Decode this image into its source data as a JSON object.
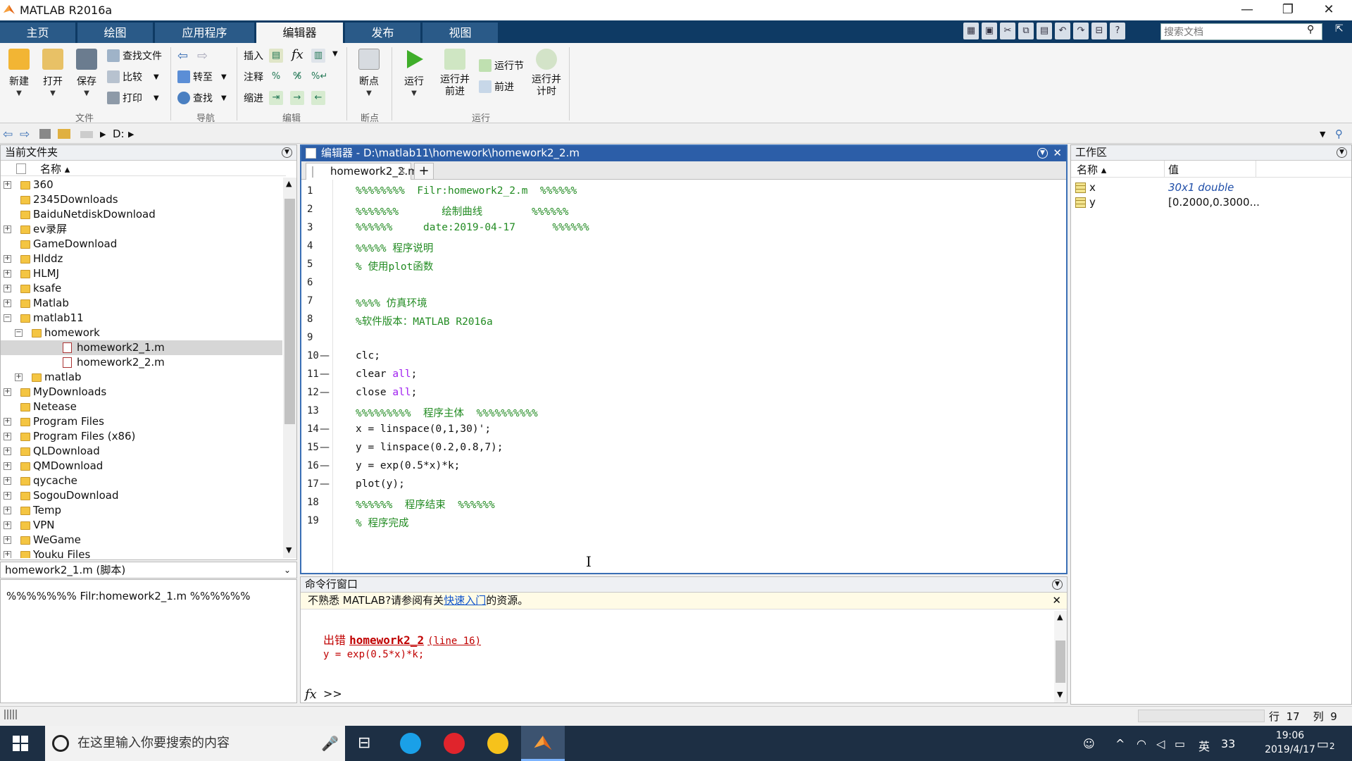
{
  "window": {
    "title": "MATLAB R2016a"
  },
  "ribbon_tabs": [
    "主页",
    "绘图",
    "应用程序",
    "编辑器",
    "发布",
    "视图"
  ],
  "search": {
    "placeholder": "搜索文档"
  },
  "ribbon": {
    "file": {
      "new": "新建",
      "open": "打开",
      "save": "保存",
      "find_files": "查找文件",
      "compare": "比较",
      "print": "打印",
      "group": "文件"
    },
    "nav": {
      "goto": "转至",
      "find": "查找",
      "group": "导航"
    },
    "edit": {
      "insert": "插入",
      "comment": "注释",
      "indent": "缩进",
      "fx": "fx",
      "group": "编辑"
    },
    "breakpoints": {
      "label": "断点",
      "group": "断点"
    },
    "run": {
      "run": "运行",
      "run_advance_1": "运行并",
      "run_advance_2": "前进",
      "run_section": "运行节",
      "advance": "前进",
      "run_time_1": "运行并",
      "run_time_2": "计时",
      "group": "运行"
    }
  },
  "address": {
    "drive": "D:"
  },
  "folder_panel": {
    "title": "当前文件夹",
    "col_name": "名称 ▴",
    "items": [
      {
        "name": "360",
        "depth": 0,
        "exp": "+",
        "type": "folder"
      },
      {
        "name": "2345Downloads",
        "depth": 0,
        "exp": "",
        "type": "folder"
      },
      {
        "name": "BaiduNetdiskDownload",
        "depth": 0,
        "exp": "",
        "type": "folder"
      },
      {
        "name": "ev录屏",
        "depth": 0,
        "exp": "+",
        "type": "folder"
      },
      {
        "name": "GameDownload",
        "depth": 0,
        "exp": "",
        "type": "folder"
      },
      {
        "name": "Hlddz",
        "depth": 0,
        "exp": "+",
        "type": "folder"
      },
      {
        "name": "HLMJ",
        "depth": 0,
        "exp": "+",
        "type": "folder"
      },
      {
        "name": "ksafe",
        "depth": 0,
        "exp": "+",
        "type": "folder"
      },
      {
        "name": "Matlab",
        "depth": 0,
        "exp": "+",
        "type": "folder"
      },
      {
        "name": "matlab11",
        "depth": 0,
        "exp": "−",
        "type": "folder"
      },
      {
        "name": "homework",
        "depth": 1,
        "exp": "−",
        "type": "folder"
      },
      {
        "name": "homework2_1.m",
        "depth": 2,
        "exp": "",
        "type": "mfile",
        "selected": true
      },
      {
        "name": "homework2_2.m",
        "depth": 2,
        "exp": "",
        "type": "mfile"
      },
      {
        "name": "matlab",
        "depth": 1,
        "exp": "+",
        "type": "folder"
      },
      {
        "name": "MyDownloads",
        "depth": 0,
        "exp": "+",
        "type": "folder"
      },
      {
        "name": "Netease",
        "depth": 0,
        "exp": "",
        "type": "folder"
      },
      {
        "name": "Program Files",
        "depth": 0,
        "exp": "+",
        "type": "folder"
      },
      {
        "name": "Program Files (x86)",
        "depth": 0,
        "exp": "+",
        "type": "folder"
      },
      {
        "name": "QLDownload",
        "depth": 0,
        "exp": "+",
        "type": "folder"
      },
      {
        "name": "QMDownload",
        "depth": 0,
        "exp": "+",
        "type": "folder"
      },
      {
        "name": "qycache",
        "depth": 0,
        "exp": "+",
        "type": "folder"
      },
      {
        "name": "SogouDownload",
        "depth": 0,
        "exp": "+",
        "type": "folder"
      },
      {
        "name": "Temp",
        "depth": 0,
        "exp": "+",
        "type": "folder"
      },
      {
        "name": "VPN",
        "depth": 0,
        "exp": "+",
        "type": "folder"
      },
      {
        "name": "WeGame",
        "depth": 0,
        "exp": "+",
        "type": "folder"
      },
      {
        "name": "Youku Files",
        "depth": 0,
        "exp": "+",
        "type": "folder"
      }
    ]
  },
  "details": {
    "title": "homework2_1.m (脚本)",
    "content": "%%%%%%% Filr:homework2_1.m %%%%%%"
  },
  "editor": {
    "title": "编辑器 - D:\\matlab11\\homework\\homework2_2.m",
    "tab": "homework2_2.m",
    "lines": [
      {
        "n": "1",
        "dash": "",
        "parts": [
          {
            "t": "%%%%%%%%  Filr:homework2_2.m  %%%%%%",
            "c": "cmt"
          }
        ]
      },
      {
        "n": "2",
        "dash": "",
        "parts": [
          {
            "t": "%%%%%%%       绘制曲线        %%%%%%",
            "c": "cmt"
          }
        ]
      },
      {
        "n": "3",
        "dash": "",
        "parts": [
          {
            "t": "%%%%%%     date:2019-04-17      %%%%%%",
            "c": "cmt"
          }
        ]
      },
      {
        "n": "4",
        "dash": "",
        "parts": [
          {
            "t": "%%%%% 程序说明",
            "c": "cmt"
          }
        ]
      },
      {
        "n": "5",
        "dash": "",
        "parts": [
          {
            "t": "% 使用plot函数",
            "c": "cmt"
          }
        ]
      },
      {
        "n": "6",
        "dash": "",
        "parts": []
      },
      {
        "n": "7",
        "dash": "",
        "parts": [
          {
            "t": "%%%% 仿真环境",
            "c": "cmt"
          }
        ]
      },
      {
        "n": "8",
        "dash": "",
        "parts": [
          {
            "t": "%软件版本：MATLAB R2016a",
            "c": "cmt"
          }
        ]
      },
      {
        "n": "9",
        "dash": "",
        "parts": []
      },
      {
        "n": "10",
        "dash": "—",
        "parts": [
          {
            "t": "clc;",
            "c": ""
          }
        ]
      },
      {
        "n": "11",
        "dash": "—",
        "parts": [
          {
            "t": "clear ",
            "c": ""
          },
          {
            "t": "all",
            "c": "kw-str"
          },
          {
            "t": ";",
            "c": ""
          }
        ]
      },
      {
        "n": "12",
        "dash": "—",
        "parts": [
          {
            "t": "close ",
            "c": ""
          },
          {
            "t": "all",
            "c": "kw-str"
          },
          {
            "t": ";",
            "c": ""
          }
        ]
      },
      {
        "n": "13",
        "dash": "",
        "parts": [
          {
            "t": "%%%%%%%%%  程序主体  %%%%%%%%%%",
            "c": "cmt"
          }
        ]
      },
      {
        "n": "14",
        "dash": "—",
        "parts": [
          {
            "t": "x = linspace(0,1,30)';",
            "c": ""
          }
        ]
      },
      {
        "n": "15",
        "dash": "—",
        "parts": [
          {
            "t": "y = linspace(0.2,0.8,7);",
            "c": ""
          }
        ]
      },
      {
        "n": "16",
        "dash": "—",
        "parts": [
          {
            "t": "y = exp(0.5*x)*k;",
            "c": ""
          }
        ]
      },
      {
        "n": "17",
        "dash": "—",
        "parts": [
          {
            "t": "plot(y);",
            "c": ""
          }
        ]
      },
      {
        "n": "18",
        "dash": "",
        "parts": [
          {
            "t": "%%%%%%  程序结束  %%%%%%",
            "c": "cmt"
          }
        ]
      },
      {
        "n": "19",
        "dash": "",
        "parts": [
          {
            "t": "% 程序完成",
            "c": "cmt"
          }
        ]
      }
    ]
  },
  "command": {
    "title": "命令行窗口",
    "notice_pre": "不熟悉 MATLAB?请参阅有关",
    "notice_link": "快速入门",
    "notice_post": "的资源。",
    "err_word": "出错",
    "err_file": "homework2_2",
    "err_line": "(line 16)",
    "err_code": "y = exp(0.5*x)*k;",
    "prompt": ">>"
  },
  "workspace": {
    "title": "工作区",
    "col_name": "名称 ▴",
    "col_value": "值",
    "vars": [
      {
        "name": "x",
        "value": "30x1 double"
      },
      {
        "name": "y",
        "value": "[0.2000,0.3000..."
      }
    ]
  },
  "status": {
    "row_label": "行",
    "row": "17",
    "col_label": "列",
    "col": "9"
  },
  "taskbar": {
    "search_placeholder": "在这里输入你要搜索的内容",
    "ime": "英",
    "time": "19:06",
    "date": "2019/4/17",
    "notif_count": "2",
    "temp": "33"
  }
}
